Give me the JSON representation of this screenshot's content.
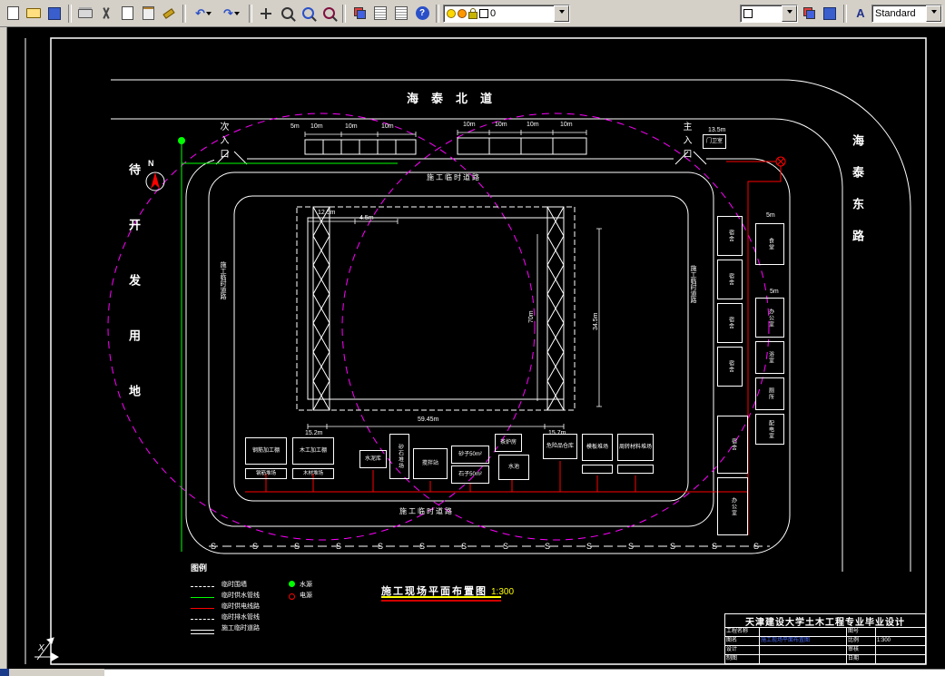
{
  "toolbar": {
    "layer_value": "0",
    "style_value": "Standard",
    "help_glyph": "?",
    "textstyle_glyph": "A",
    "undo_glyph": "↶",
    "redo_glyph": "↷",
    "icons": [
      "new",
      "open",
      "save",
      "plot",
      "cut",
      "copy",
      "paste",
      "match-properties",
      "undo",
      "redo",
      "pan",
      "zoom-realtime",
      "zoom-window",
      "zoom-previous",
      "layer-manager",
      "layer-states",
      "properties",
      "help",
      "layer-on",
      "layer-sun",
      "layer-lock",
      "layer-color",
      "color-control",
      "layer-previous",
      "make-object-layer-current",
      "text-style"
    ]
  },
  "drawing": {
    "roads": {
      "north": "海泰北道",
      "east": "海泰东路"
    },
    "left_area": "待开发用地",
    "entrances": {
      "secondary": "次入口",
      "primary": "主入口"
    },
    "temp_road": "施工临时道路",
    "north_label": "N",
    "ucs_label": "X",
    "s_mark": "S",
    "title": {
      "text": "施工现场平面布置图",
      "scale": "1:300"
    },
    "dims": {
      "d1": "12.5m",
      "d2": "4.5m",
      "d3": "70m",
      "d4": "34.5m",
      "d5": "59.45m",
      "d6": "15.2m",
      "d7": "15.7m",
      "d8": "13.5m",
      "d10": "10m",
      "d5m": "5m"
    },
    "facilities_bottom": [
      {
        "label": "钢筋加工棚"
      },
      {
        "label": "钢筋堆场"
      },
      {
        "label": "木工加工棚"
      },
      {
        "label": "木材堆场"
      },
      {
        "label": "水泥库"
      },
      {
        "label": "砂石堆场"
      },
      {
        "label": "搅拌站"
      },
      {
        "label": "砂子50m²"
      },
      {
        "label": "石子50m²"
      },
      {
        "label": "茶炉房"
      },
      {
        "label": "水池"
      },
      {
        "label": "危险品仓库"
      },
      {
        "label": "模板堆场"
      },
      {
        "label": "周转材料堆场"
      }
    ],
    "facilities_right": [
      {
        "label": "门卫室"
      },
      {
        "label": "食堂"
      },
      {
        "label": "宿舍"
      },
      {
        "label": "宿舍"
      },
      {
        "label": "宿舍"
      },
      {
        "label": "宿舍"
      },
      {
        "label": "办公室"
      },
      {
        "label": "浴室"
      },
      {
        "label": "厕所"
      },
      {
        "label": "配电室"
      },
      {
        "label": "宿舍"
      },
      {
        "label": "办公室"
      }
    ],
    "legend": {
      "title": "图例",
      "items": [
        {
          "label": "临时围墙"
        },
        {
          "label": "临时供水管线"
        },
        {
          "label": "临时供电线路"
        },
        {
          "label": "临时排水管线"
        },
        {
          "label": "施工临时道路"
        },
        {
          "label": "水源"
        },
        {
          "label": "电源"
        }
      ]
    },
    "title_block": {
      "header": "天津建设大学土木工程专业毕业设计",
      "rows": [
        {
          "c1": "工程名称",
          "c2": "",
          "c3": "图号",
          "c4": ""
        },
        {
          "c1": "图名",
          "c2": "施工现场平面布置图",
          "c3": "比例",
          "c4": "1:300"
        },
        {
          "c1": "设计",
          "c2": "",
          "c3": "审核",
          "c4": ""
        },
        {
          "c1": "制图",
          "c2": "",
          "c3": "日期",
          "c4": ""
        }
      ]
    },
    "colors": {
      "line": "#ffffff",
      "power": "#ff0000",
      "water": "#00ff00",
      "crane_radius": "#ff00ff",
      "scale_text": "#ffff00"
    }
  }
}
